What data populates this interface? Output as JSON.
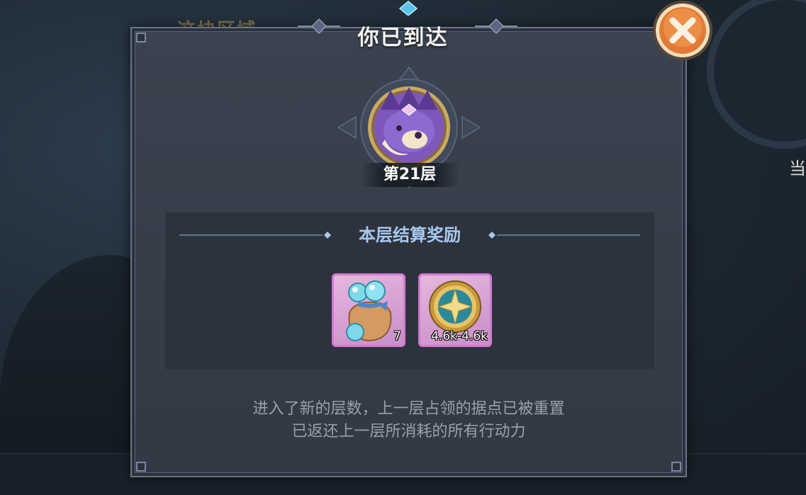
{
  "background": {
    "top_left_text": "这块区域",
    "right_edge_text": "当"
  },
  "dialog": {
    "title": "你已到达",
    "floor_label": "第21层",
    "rewards": {
      "title": "本层结算奖励",
      "items": [
        {
          "name": "gem-bag-icon",
          "count": "7"
        },
        {
          "name": "star-coin-icon",
          "count": "4.6k-4.6k"
        }
      ]
    },
    "note_lines": [
      "进入了新的层数，上一层占领的据点已被重置",
      "已返还上一层所消耗的所有行动力"
    ]
  },
  "colors": {
    "panel": "#383f4b",
    "reward_title": "#a8c9ee",
    "item_border": "#d27ad0",
    "close_button": "#e58a3c"
  }
}
